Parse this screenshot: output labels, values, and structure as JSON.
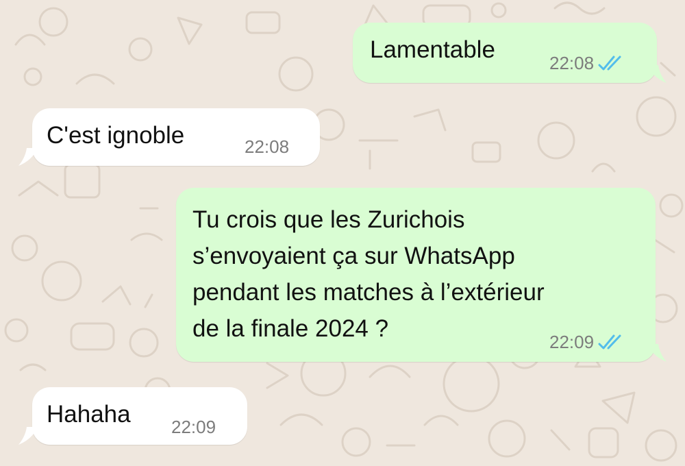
{
  "conversation": {
    "messages": [
      {
        "direction": "outgoing",
        "text": "Lamentable",
        "time": "22:08",
        "status_icon": "double-check-read-icon"
      },
      {
        "direction": "incoming",
        "text": "C'est ignoble",
        "time": "22:08"
      },
      {
        "direction": "outgoing",
        "text_lines": [
          "Tu crois que les Zurichois",
          "s’envoyaient ça sur WhatsApp",
          "pendant les matches à l’extérieur",
          "de la finale 2024 ?"
        ],
        "time": "22:09",
        "status_icon": "double-check-read-icon"
      },
      {
        "direction": "incoming",
        "text": "Hahaha",
        "time": "22:09"
      }
    ]
  },
  "colors": {
    "wallpaper": "#efe7de",
    "outgoing_bubble": "#d9fdd3",
    "incoming_bubble": "#ffffff",
    "text": "#111111",
    "timestamp": "#7c7c7c",
    "read_check": "#53bdeb"
  }
}
